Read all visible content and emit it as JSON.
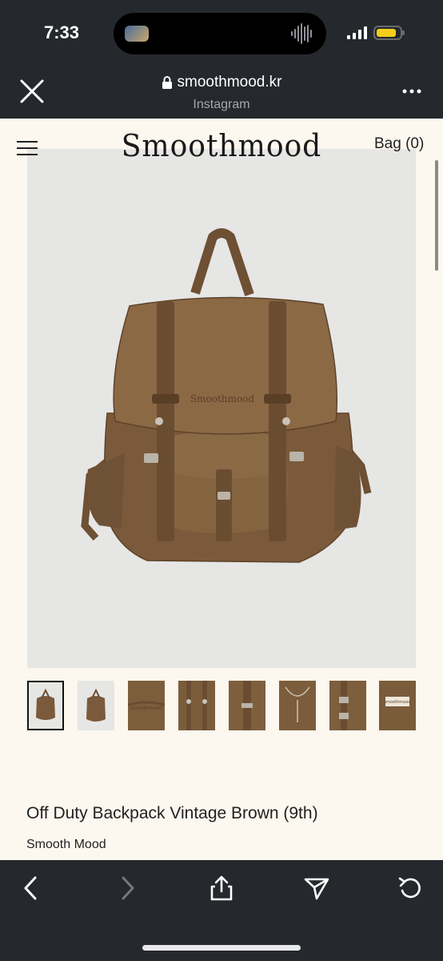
{
  "status_bar": {
    "time": "7:33"
  },
  "browser": {
    "url": "smoothmood.kr",
    "subtitle": "Instagram"
  },
  "site": {
    "logo": "Smoothmood",
    "bag_label": "Bag (0)"
  },
  "product": {
    "title": "Off Duty Backpack Vintage Brown (9th)",
    "brand": "Smooth Mood",
    "bag_print": "Smoothmood",
    "thumbnail_count": 8,
    "selected_thumbnail": 1
  },
  "colors": {
    "chrome": "#25282d",
    "page_bg": "#fcf7ef",
    "bag_brown": "#7c5e3e",
    "battery": "#f5cd1b"
  },
  "icons": {
    "close": "close-icon",
    "lock": "lock-icon",
    "more": "more-icon",
    "menu": "hamburger-icon",
    "back": "chevron-left-icon",
    "forward": "chevron-right-icon",
    "share": "share-icon",
    "send": "send-icon",
    "reload": "reload-icon"
  }
}
